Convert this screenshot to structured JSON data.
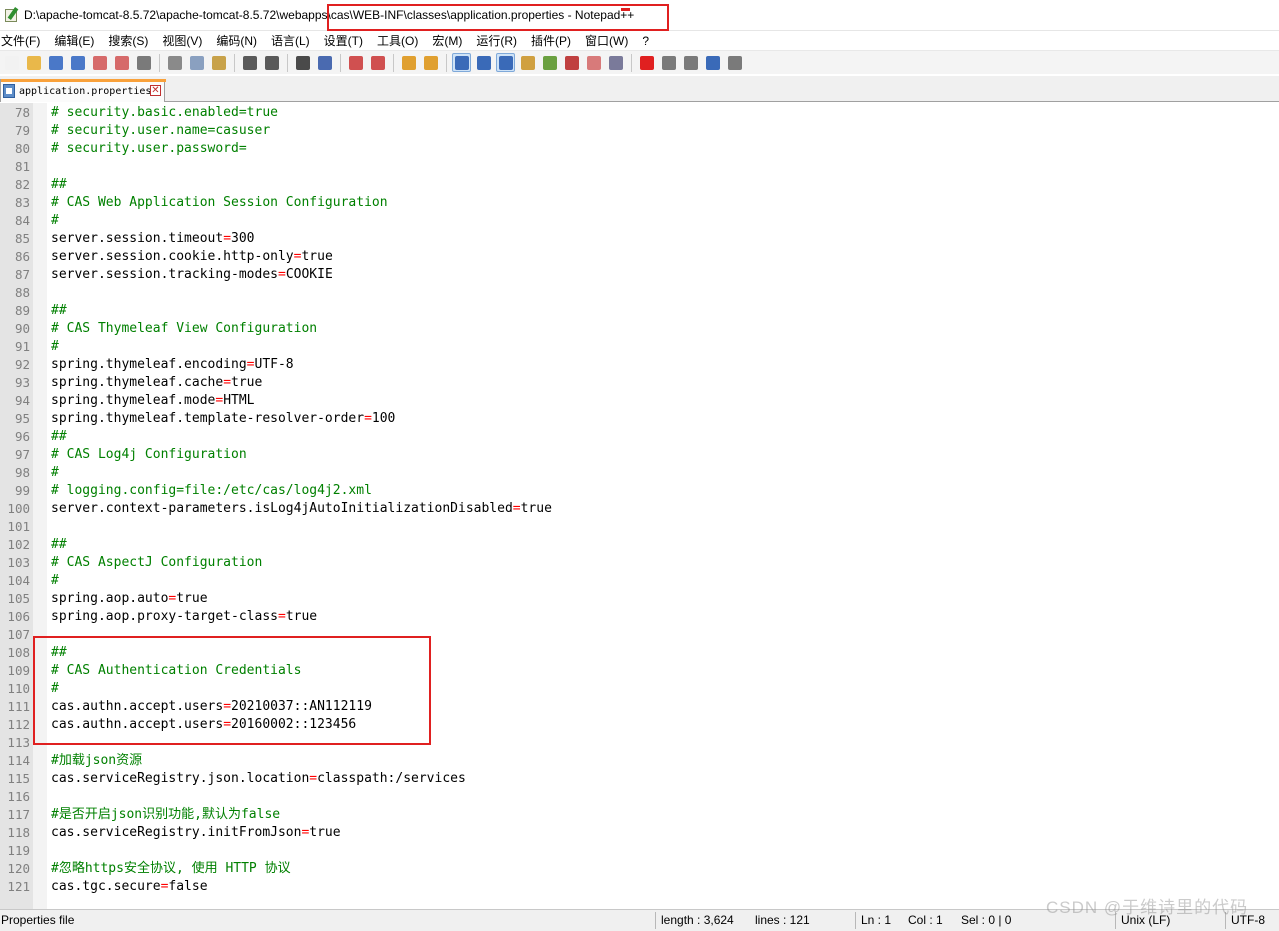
{
  "window": {
    "title": "D:\\apache-tomcat-8.5.72\\apache-tomcat-8.5.72\\webapps\\cas\\WEB-INF\\classes\\application.properties - Notepad++",
    "icon": "notepad-plus-plus-icon"
  },
  "menu": [
    "文件(F)",
    "编辑(E)",
    "搜索(S)",
    "视图(V)",
    "编码(N)",
    "语言(L)",
    "设置(T)",
    "工具(O)",
    "宏(M)",
    "运行(R)",
    "插件(P)",
    "窗口(W)",
    "?"
  ],
  "toolbar": {
    "buttons": [
      {
        "name": "new-file-icon",
        "color": "#f2f2f2"
      },
      {
        "name": "open-file-icon",
        "color": "#e9b84a"
      },
      {
        "name": "save-icon",
        "color": "#4a78c8"
      },
      {
        "name": "save-all-icon",
        "color": "#4a78c8"
      },
      {
        "name": "close-icon",
        "color": "#d66a6a"
      },
      {
        "name": "close-all-icon",
        "color": "#d66a6a"
      },
      {
        "name": "print-icon",
        "color": "#7a7a7a"
      },
      {
        "name": "cut-icon",
        "color": "#8a8a8a"
      },
      {
        "name": "copy-icon",
        "color": "#8aa0c0"
      },
      {
        "name": "paste-icon",
        "color": "#c8a24a"
      },
      {
        "name": "undo-icon",
        "color": "#5a5a5a"
      },
      {
        "name": "redo-icon",
        "color": "#5a5a5a"
      },
      {
        "name": "find-icon",
        "color": "#4a4a4a"
      },
      {
        "name": "replace-icon",
        "color": "#4a6ab0"
      },
      {
        "name": "zoom-in-icon",
        "color": "#d05050"
      },
      {
        "name": "zoom-out-icon",
        "color": "#d05050"
      },
      {
        "name": "sync-vertical-icon",
        "color": "#e0a030"
      },
      {
        "name": "sync-horizontal-icon",
        "color": "#e0a030"
      },
      {
        "name": "word-wrap-icon",
        "color": "#3a6ab8",
        "active": true
      },
      {
        "name": "show-all-chars-icon",
        "color": "#3a6ab8"
      },
      {
        "name": "indent-guide-icon",
        "color": "#3a6ab8",
        "active": true
      },
      {
        "name": "user-lang-icon",
        "color": "#d0a040"
      },
      {
        "name": "document-map-icon",
        "color": "#6aa040"
      },
      {
        "name": "function-list-icon",
        "color": "#c04040"
      },
      {
        "name": "folder-workspace-icon",
        "color": "#d87a7a"
      },
      {
        "name": "monitoring-icon",
        "color": "#7a7a9a"
      },
      {
        "name": "record-macro-icon",
        "color": "#e02020"
      },
      {
        "name": "stop-record-icon",
        "color": "#7a7a7a"
      },
      {
        "name": "play-macro-icon",
        "color": "#7a7a7a"
      },
      {
        "name": "run-macro-multiple-icon",
        "color": "#3a6ab8"
      },
      {
        "name": "save-macro-icon",
        "color": "#7a7a7a"
      }
    ]
  },
  "tab": {
    "label": "application.properties",
    "close": "✕"
  },
  "editor": {
    "lines": [
      {
        "n": "78",
        "t": "# security.basic.enabled=true",
        "kind": "comment"
      },
      {
        "n": "79",
        "t": "# security.user.name=casuser",
        "kind": "comment"
      },
      {
        "n": "80",
        "t": "# security.user.password=",
        "kind": "comment"
      },
      {
        "n": "81",
        "t": "",
        "kind": "blank"
      },
      {
        "n": "82",
        "t": "##",
        "kind": "comment"
      },
      {
        "n": "83",
        "t": "# CAS Web Application Session Configuration",
        "kind": "comment"
      },
      {
        "n": "84",
        "t": "#",
        "kind": "comment"
      },
      {
        "n": "85",
        "k": "server.session.timeout",
        "v": "300",
        "kind": "prop"
      },
      {
        "n": "86",
        "k": "server.session.cookie.http-only",
        "v": "true",
        "kind": "prop"
      },
      {
        "n": "87",
        "k": "server.session.tracking-modes",
        "v": "COOKIE",
        "kind": "prop"
      },
      {
        "n": "88",
        "t": "",
        "kind": "blank"
      },
      {
        "n": "89",
        "t": "##",
        "kind": "comment"
      },
      {
        "n": "90",
        "t": "# CAS Thymeleaf View Configuration",
        "kind": "comment"
      },
      {
        "n": "91",
        "t": "#",
        "kind": "comment"
      },
      {
        "n": "92",
        "k": "spring.thymeleaf.encoding",
        "v": "UTF-8",
        "kind": "prop"
      },
      {
        "n": "93",
        "k": "spring.thymeleaf.cache",
        "v": "true",
        "kind": "prop"
      },
      {
        "n": "94",
        "k": "spring.thymeleaf.mode",
        "v": "HTML",
        "kind": "prop"
      },
      {
        "n": "95",
        "k": "spring.thymeleaf.template-resolver-order",
        "v": "100",
        "kind": "prop"
      },
      {
        "n": "96",
        "t": "##",
        "kind": "comment"
      },
      {
        "n": "97",
        "t": "# CAS Log4j Configuration",
        "kind": "comment"
      },
      {
        "n": "98",
        "t": "#",
        "kind": "comment"
      },
      {
        "n": "99",
        "t": "# logging.config=file:/etc/cas/log4j2.xml",
        "kind": "comment"
      },
      {
        "n": "100",
        "k": "server.context-parameters.isLog4jAutoInitializationDisabled",
        "v": "true",
        "kind": "prop"
      },
      {
        "n": "101",
        "t": "",
        "kind": "blank"
      },
      {
        "n": "102",
        "t": "##",
        "kind": "comment"
      },
      {
        "n": "103",
        "t": "# CAS AspectJ Configuration",
        "kind": "comment"
      },
      {
        "n": "104",
        "t": "#",
        "kind": "comment"
      },
      {
        "n": "105",
        "k": "spring.aop.auto",
        "v": "true",
        "kind": "prop"
      },
      {
        "n": "106",
        "k": "spring.aop.proxy-target-class",
        "v": "true",
        "kind": "prop"
      },
      {
        "n": "107",
        "t": "",
        "kind": "blank"
      },
      {
        "n": "108",
        "t": "##",
        "kind": "comment"
      },
      {
        "n": "109",
        "t": "# CAS Authentication Credentials",
        "kind": "comment"
      },
      {
        "n": "110",
        "t": "#",
        "kind": "comment"
      },
      {
        "n": "111",
        "k": "cas.authn.accept.users",
        "v": "20210037::AN112119",
        "kind": "prop"
      },
      {
        "n": "112",
        "k": "cas.authn.accept.users",
        "v": "20160002::123456",
        "kind": "prop"
      },
      {
        "n": "113",
        "t": "",
        "kind": "blank"
      },
      {
        "n": "114",
        "t": "#加载json资源",
        "kind": "comment"
      },
      {
        "n": "115",
        "k": "cas.serviceRegistry.json.location",
        "v": "classpath:/services",
        "kind": "prop"
      },
      {
        "n": "116",
        "t": "",
        "kind": "blank"
      },
      {
        "n": "117",
        "t": "#是否开启json识别功能,默认为false",
        "kind": "comment"
      },
      {
        "n": "118",
        "k": "cas.serviceRegistry.initFromJson",
        "v": "true",
        "kind": "prop"
      },
      {
        "n": "119",
        "t": "",
        "kind": "blank"
      },
      {
        "n": "120",
        "t": "#忽略https安全协议, 使用 HTTP 协议",
        "kind": "comment"
      },
      {
        "n": "121",
        "k": "cas.tgc.secure",
        "v": "false",
        "kind": "prop"
      }
    ]
  },
  "status": {
    "file_type": "Properties file",
    "length": "length : 3,624",
    "lines": "lines : 121",
    "ln": "Ln : 1",
    "col": "Col : 1",
    "sel": "Sel : 0 | 0",
    "eol": "Unix (LF)",
    "encoding": "UTF-8"
  },
  "watermark": "CSDN @于维诗里的代码",
  "colors": {
    "comment": "#008000",
    "operator": "#ff0000",
    "annotation": "#e02020",
    "tab_accent": "#f9a13a"
  }
}
